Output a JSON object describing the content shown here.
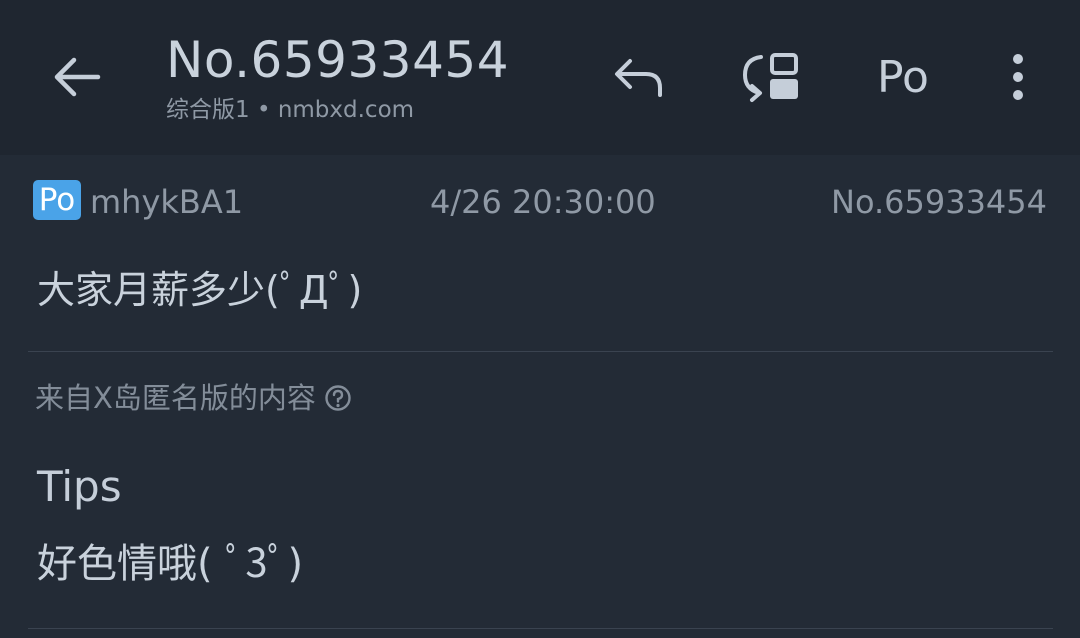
{
  "appbar": {
    "title": "No.65933454",
    "subtitle": "综合版1 • nmbxd.com",
    "po_label": "Po",
    "icons": {
      "back": "arrow-back-icon",
      "reply": "reply-icon",
      "jump": "jump-page-icon",
      "more": "more-vert-icon"
    }
  },
  "post": {
    "badge": "Po",
    "user_id": "mhykBA1",
    "time": "4/26 20:30:00",
    "number": "No.65933454",
    "content": "大家月薪多少(ﾟДﾟ)"
  },
  "source_note": "来自X岛匿名版的内容",
  "tips": {
    "title": "Tips",
    "text": "好色情哦( ﾟ3ﾟ)"
  },
  "colors": {
    "background": "#232b36",
    "appbar": "#1f2630",
    "badge": "#4aa3e8"
  }
}
